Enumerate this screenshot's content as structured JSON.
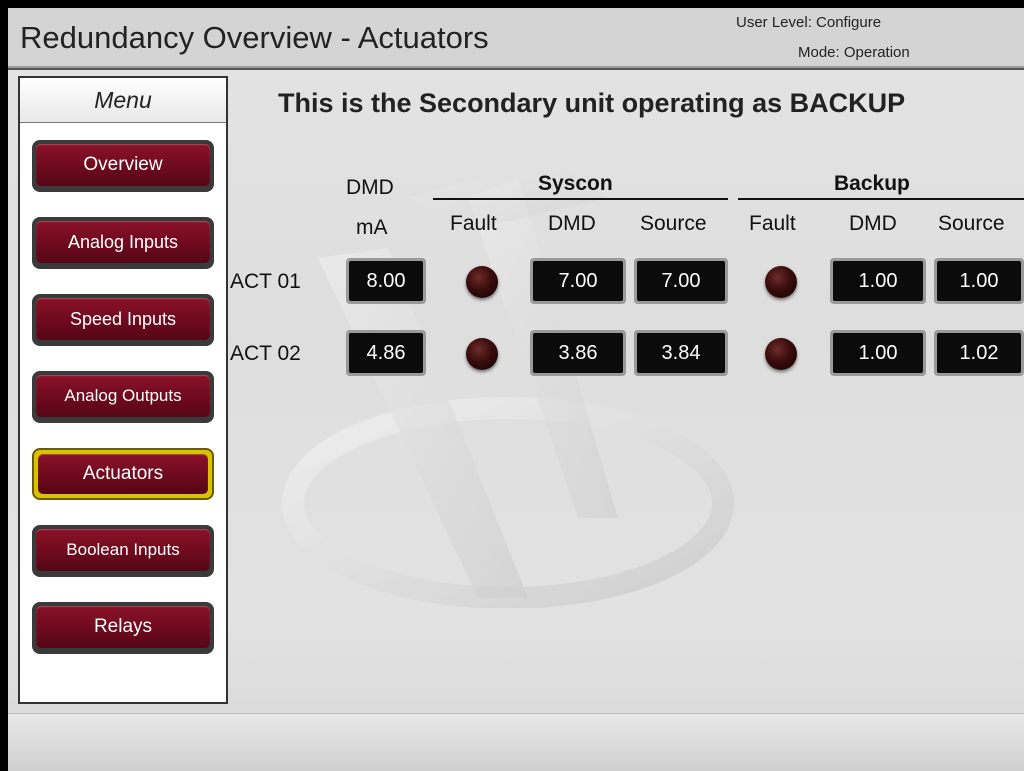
{
  "header": {
    "title": "Redundancy Overview - Actuators",
    "user_level": "User Level: Configure",
    "mode": "Mode: Operation"
  },
  "menu": {
    "title": "Menu",
    "items": [
      {
        "label": "Overview"
      },
      {
        "label": "Analog Inputs"
      },
      {
        "label": "Speed Inputs"
      },
      {
        "label": "Analog Outputs"
      },
      {
        "label": "Actuators"
      },
      {
        "label": "Boolean Inputs"
      },
      {
        "label": "Relays"
      }
    ],
    "active": "Actuators"
  },
  "status_message": "This is the Secondary unit operating as BACKUP",
  "table": {
    "dmd_header_line1": "DMD",
    "dmd_header_line2": "mA",
    "group_syscon": "Syscon",
    "group_backup": "Backup",
    "col_fault": "Fault",
    "col_dmd": "DMD",
    "col_source": "Source",
    "rows": [
      {
        "label": "ACT 01",
        "dmd_ma": "8.00",
        "syscon_dmd": "7.00",
        "syscon_source": "7.00",
        "backup_dmd": "1.00",
        "backup_source": "1.00"
      },
      {
        "label": "ACT 02",
        "dmd_ma": "4.86",
        "syscon_dmd": "3.86",
        "syscon_source": "3.84",
        "backup_dmd": "1.00",
        "backup_source": "1.02"
      }
    ]
  },
  "colors": {
    "button_red": "#7a0d22",
    "active_outline": "#d9c200",
    "led_off": "#3a0c0c"
  }
}
